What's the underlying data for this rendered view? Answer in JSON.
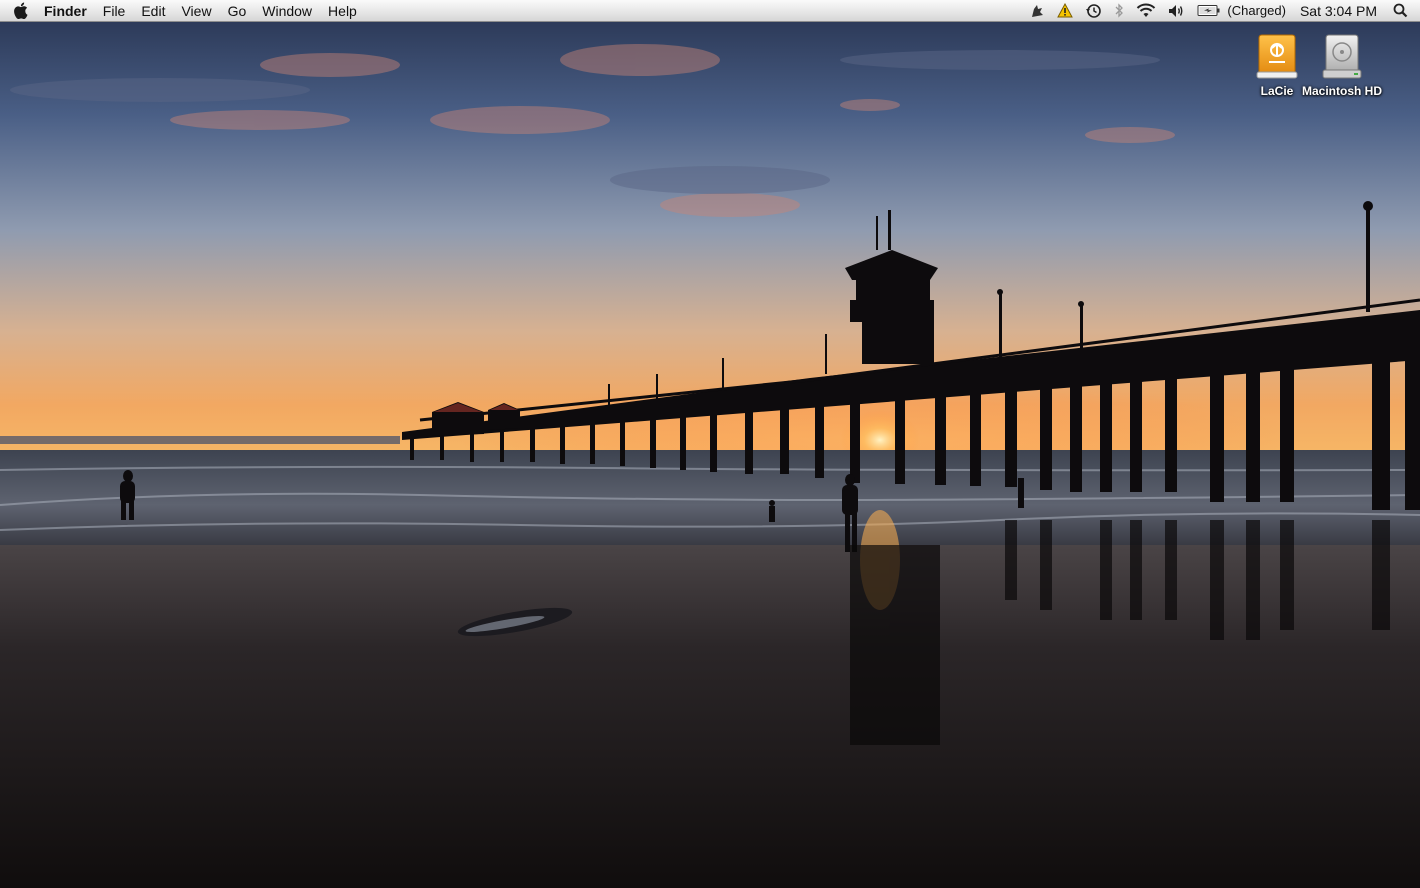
{
  "menubar": {
    "apple_icon": "apple-icon",
    "app_name": "Finder",
    "menus": [
      "File",
      "Edit",
      "View",
      "Go",
      "Window",
      "Help"
    ],
    "status_icons": [
      "growl-icon",
      "warning-icon",
      "time-machine-icon",
      "bluetooth-icon",
      "wifi-icon",
      "volume-icon",
      "battery-icon"
    ],
    "battery_status": "(Charged)",
    "clock": "Sat 3:04 PM",
    "spotlight_icon": "spotlight-icon"
  },
  "desktop": {
    "icons": [
      {
        "label": "LaCie",
        "icon": "external-drive-icon",
        "color": "#f5a21b"
      },
      {
        "label": "Macintosh HD",
        "icon": "hard-drive-icon",
        "color": "#c8c8c8"
      }
    ]
  },
  "colors": {
    "sky_top": "#2f3d5e",
    "sky_horizon": "#f3b46a",
    "sea": "#2d3440",
    "sand": "#1a1614"
  }
}
